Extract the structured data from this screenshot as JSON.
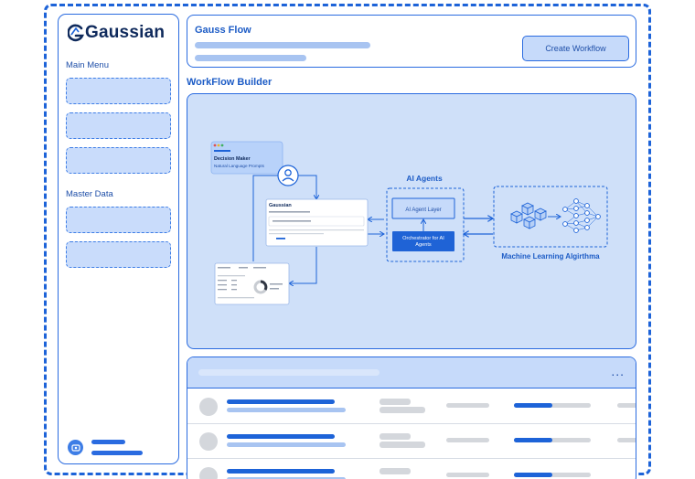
{
  "brand": {
    "name": "Gaussian"
  },
  "sidebar": {
    "main_menu_label": "Main Menu",
    "master_data_label": "Master Data"
  },
  "header": {
    "title": "Gauss Flow",
    "create_button": "Create Workflow"
  },
  "builder": {
    "title": "WorkFlow Builder",
    "decision_maker": {
      "title": "Decision Maker",
      "subtitle": "Natural Language Prompts"
    },
    "app_window_brand": "Gaussian",
    "ai_agents": {
      "title": "AI Agents",
      "layer": "AI Agent Layer",
      "orchestrator_line1": "Orchestrator for AI",
      "orchestrator_line2": "Agents"
    },
    "ml_label": "Machine Learning Algirthma"
  },
  "table": {
    "more_label": "...",
    "rows_visible": 3
  },
  "colors": {
    "accent": "#1d63d8",
    "canvas_bg": "#cfe0f9",
    "slot_bg": "#c9dcfb",
    "primary_button": "#1f63d6"
  }
}
